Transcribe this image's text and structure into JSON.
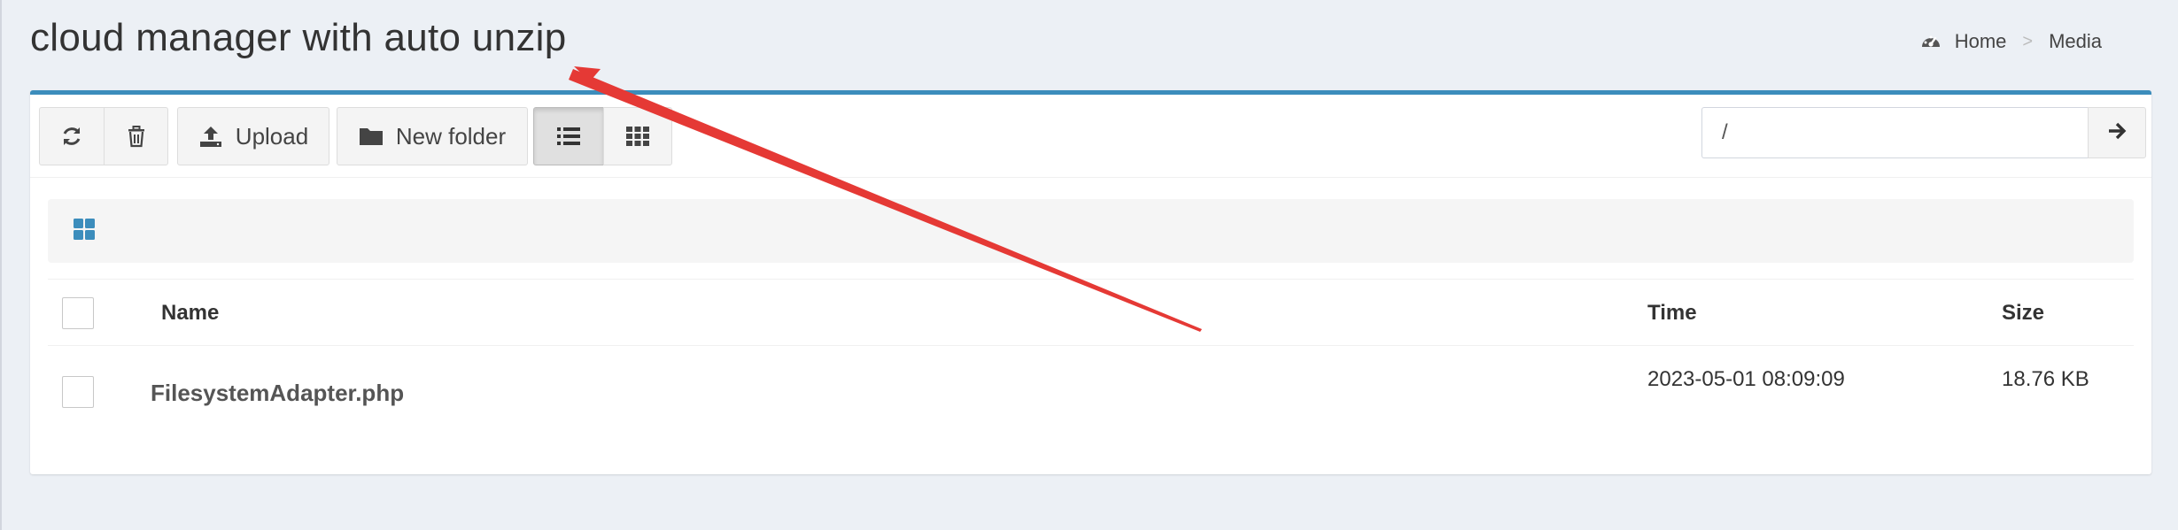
{
  "page": {
    "title": "cloud manager with auto unzip"
  },
  "breadcrumb": {
    "icon": "dashboard-icon",
    "items": [
      {
        "label": "Home"
      },
      {
        "label": "Media"
      }
    ],
    "separator": ">"
  },
  "toolbar": {
    "refresh_icon": "refresh-icon",
    "delete_icon": "trash-icon",
    "upload_label": "Upload",
    "new_folder_label": "New folder",
    "list_view_icon": "list-icon",
    "grid_view_icon": "grid-icon",
    "path_value": "/",
    "go_icon": "arrow-right-icon"
  },
  "path_bar": {
    "home_icon": "grid-small-icon"
  },
  "table": {
    "columns": [
      "Name",
      "Time",
      "Size"
    ],
    "rows": [
      {
        "name": "FilesystemAdapter.php",
        "time": "2023-05-01 08:09:09",
        "size": "18.76 KB"
      }
    ]
  },
  "colors": {
    "accent": "#3c8dbc",
    "annotation_arrow": "#e53935",
    "background": "#ecf0f5"
  }
}
